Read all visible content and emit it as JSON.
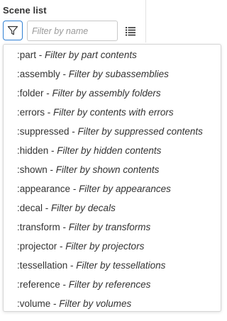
{
  "panel": {
    "title": "Scene list"
  },
  "search": {
    "placeholder": "Filter by name",
    "value": ""
  },
  "icons": {
    "filter": "filter-funnel-icon",
    "list_view": "list-view-icon"
  },
  "colors": {
    "accent": "#2f7fd3",
    "text": "#333333",
    "border": "#d6d6d6"
  },
  "filter_options": [
    {
      "key": ":part",
      "desc": "Filter by part contents"
    },
    {
      "key": ":assembly",
      "desc": "Filter by subassemblies"
    },
    {
      "key": ":folder",
      "desc": "Filter by assembly folders"
    },
    {
      "key": ":errors",
      "desc": "Filter by contents with errors"
    },
    {
      "key": ":suppressed",
      "desc": "Filter by suppressed contents"
    },
    {
      "key": ":hidden",
      "desc": "Filter by hidden contents"
    },
    {
      "key": ":shown",
      "desc": "Filter by shown contents"
    },
    {
      "key": ":appearance",
      "desc": "Filter by appearances"
    },
    {
      "key": ":decal",
      "desc": "Filter by decals"
    },
    {
      "key": ":transform",
      "desc": "Filter by transforms"
    },
    {
      "key": ":projector",
      "desc": "Filter by projectors"
    },
    {
      "key": ":tessellation",
      "desc": "Filter by tessellations"
    },
    {
      "key": ":reference",
      "desc": "Filter by references"
    },
    {
      "key": ":volume",
      "desc": "Filter by volumes"
    }
  ]
}
